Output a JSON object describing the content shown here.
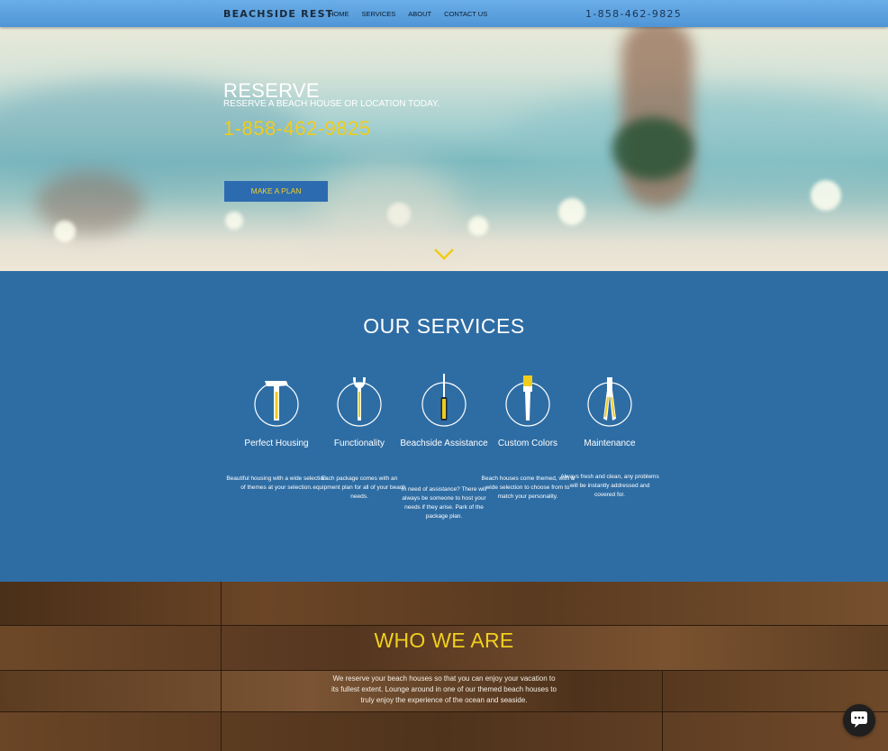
{
  "nav": {
    "brand": "BEACHSIDE REST",
    "items": [
      "HOME",
      "SERVICES",
      "ABOUT",
      "CONTACT US"
    ],
    "phone": "1-858-462-9825"
  },
  "hero": {
    "title": "RESERVE",
    "subtitle": "RESERVE A BEACH HOUSE OR LOCATION TODAY.",
    "phone": "1-858-462-9825",
    "button": "MAKE A PLAN"
  },
  "services": {
    "title": "OUR SERVICES",
    "items": [
      {
        "name": "Perfect Housing",
        "desc": "Beautiful housing with a wide selection of themes at your selection.",
        "icon": "hammer-icon"
      },
      {
        "name": "Functionality",
        "desc": "Each package comes with an equipment plan for all of your beach needs.",
        "icon": "wrench-icon"
      },
      {
        "name": "Beachside Assistance",
        "desc": "In need of assistance? There will always be someone to host your needs if they arise. Park of the package plan.",
        "icon": "screwdriver-icon"
      },
      {
        "name": "Custom Colors",
        "desc": "Beach houses come themed, with a wide selection to choose from to match your personality.",
        "icon": "paintbrush-icon"
      },
      {
        "name": "Maintenance",
        "desc": "Always fresh and clean, any problems will be instantly addressed and covered for.",
        "icon": "pliers-icon"
      }
    ]
  },
  "who": {
    "title": "WHO WE ARE",
    "text": "We reserve your beach houses so that you can enjoy your vacation to its fullest extent. Lounge around in one of our themed beach houses to truly enjoy the experience of the ocean and seaside."
  },
  "colors": {
    "accent": "#f0cc1a",
    "blue": "#2e6da4",
    "nav": "#5aa0de"
  }
}
